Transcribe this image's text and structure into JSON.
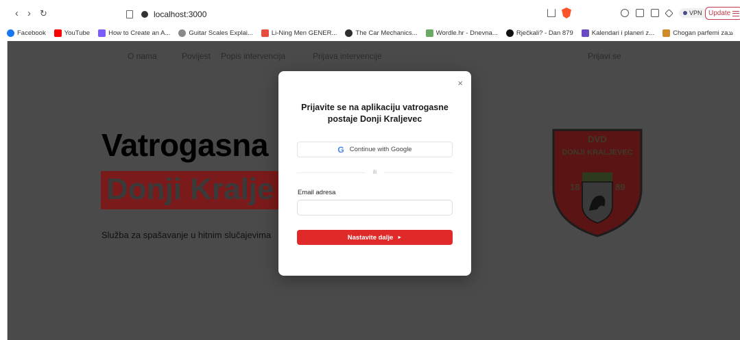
{
  "browser": {
    "nav": {
      "back": "‹",
      "forward": "›",
      "reload": "↻"
    },
    "url": "localhost:3000",
    "vpn_label": "VPN",
    "update_label": "Update",
    "bookmarks": [
      {
        "label": "Facebook",
        "color": "#1877f2"
      },
      {
        "label": "YouTube",
        "color": "#ff0000"
      },
      {
        "label": "How to Create an A...",
        "color": "#7b5cff"
      },
      {
        "label": "Guitar Scales Explai...",
        "color": "#8a8a8a"
      },
      {
        "label": "Li-Ning Men GENER...",
        "color": "#e84c3d"
      },
      {
        "label": "The Car Mechanics...",
        "color": "#2d2d2d"
      },
      {
        "label": "Wordle.hr - Dnevna...",
        "color": "#6aaa64"
      },
      {
        "label": "Rječkali? - Dan 879",
        "color": "#111111"
      },
      {
        "label": "Kalendari i planeri z...",
        "color": "#6a4bc4"
      },
      {
        "label": "Chogan parfemi za...",
        "color": "#d08a2a"
      }
    ],
    "more": "»"
  },
  "site": {
    "nav": [
      "O nama",
      "Povijest",
      "Popis intervencija",
      "Prijava intervencije"
    ],
    "login": "Prijavi se",
    "hero_title": "Vatrogasna",
    "hero_highlight": "Donji Kralje",
    "hero_subtitle": "Služba za spašavanje u hitnim slučajevima",
    "crest": {
      "top_text": "DVD",
      "arc_text": "DONJI KRALJEVEC",
      "year_left": "18",
      "year_right": "89"
    }
  },
  "modal": {
    "close": "×",
    "title": "Prijavite se na aplikaciju vatrogasne postaje Donji Kraljevec",
    "google_label": "Continue with Google",
    "divider": "ili",
    "email_label": "Email adresa",
    "email_value": "",
    "submit_label": "Nastavite dalje",
    "submit_arrow": "►"
  }
}
